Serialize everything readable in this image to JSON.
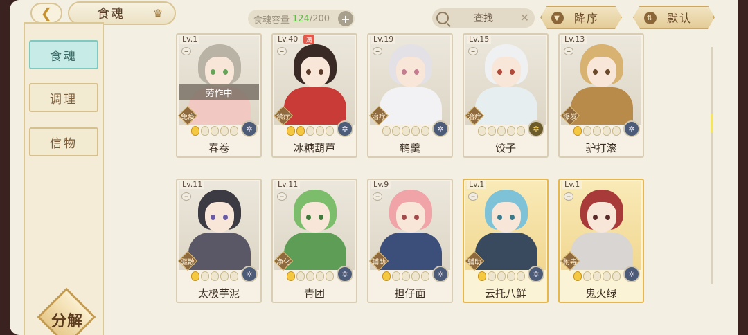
{
  "header": {
    "title": "食魂",
    "capacity_label": "食魂容量",
    "capacity_current": "124",
    "capacity_total": "/200",
    "search_label": "查找",
    "sort_label": "降序",
    "default_label": "默认"
  },
  "sidebar": {
    "tabs": [
      {
        "label": "食魂"
      },
      {
        "label": "调理"
      },
      {
        "label": "信物"
      }
    ],
    "decompose_label": "分解"
  },
  "cards": [
    {
      "level": "Lv.1",
      "role": "免疫",
      "name": "春卷",
      "status": "劳作中",
      "stars_on": 1,
      "element": "✲",
      "hair": "#b9b3a6",
      "body": "#f1c9c2",
      "eye": "#67a55a"
    },
    {
      "level": "Lv.40",
      "role": "禁疗",
      "name": "冰糖葫芦",
      "badge": "满",
      "stars_on": 2,
      "element": "✲",
      "hair": "#3a2a26",
      "body": "#c83b36",
      "eye": "#5b3a2a"
    },
    {
      "level": "Lv.19",
      "role": "治疗",
      "name": "鹌羹",
      "stars_on": 0,
      "element": "✲",
      "hair": "#e3e1e6",
      "body": "#f2f2f4",
      "eye": "#c47d8f"
    },
    {
      "level": "Lv.15",
      "role": "治疗",
      "name": "饺子",
      "stars_on": 0,
      "element": "✲",
      "hair": "#eef0f2",
      "body": "#e6eef0",
      "eye": "#b24a3c",
      "gold_element": true
    },
    {
      "level": "Lv.13",
      "role": "爆发",
      "name": "驴打滚",
      "stars_on": 1,
      "element": "✲",
      "hair": "#d8b270",
      "body": "#b98b4a",
      "eye": "#6a4a2a"
    },
    {
      "level": "Lv.11",
      "role": "驱散",
      "name": "太极芋泥",
      "stars_on": 1,
      "element": "✲",
      "hair": "#3c3a42",
      "body": "#5a5866",
      "eye": "#6b5aa6"
    },
    {
      "level": "Lv.11",
      "role": "净化",
      "name": "青团",
      "stars_on": 1,
      "element": "✲",
      "hair": "#7bbd6a",
      "body": "#5e9d55",
      "eye": "#3f7a3a"
    },
    {
      "level": "Lv.9",
      "role": "辅助",
      "name": "担仔面",
      "stars_on": 1,
      "element": "✲",
      "hair": "#f0a4a8",
      "body": "#3c4e7a",
      "eye": "#a34a4a"
    },
    {
      "level": "Lv.1",
      "role": "辅助",
      "name": "云托八鲜",
      "stars_on": 1,
      "element": "✲",
      "gold": true,
      "hair": "#7ec2d8",
      "body": "#3a4a5e",
      "eye": "#3a7a8a"
    },
    {
      "level": "Lv.1",
      "role": "附毒",
      "name": "鬼火绿",
      "stars_on": 1,
      "element": "✲",
      "gold": true,
      "hair": "#a83a3a",
      "body": "#d9d5d2",
      "eye": "#5a2a2a"
    }
  ]
}
